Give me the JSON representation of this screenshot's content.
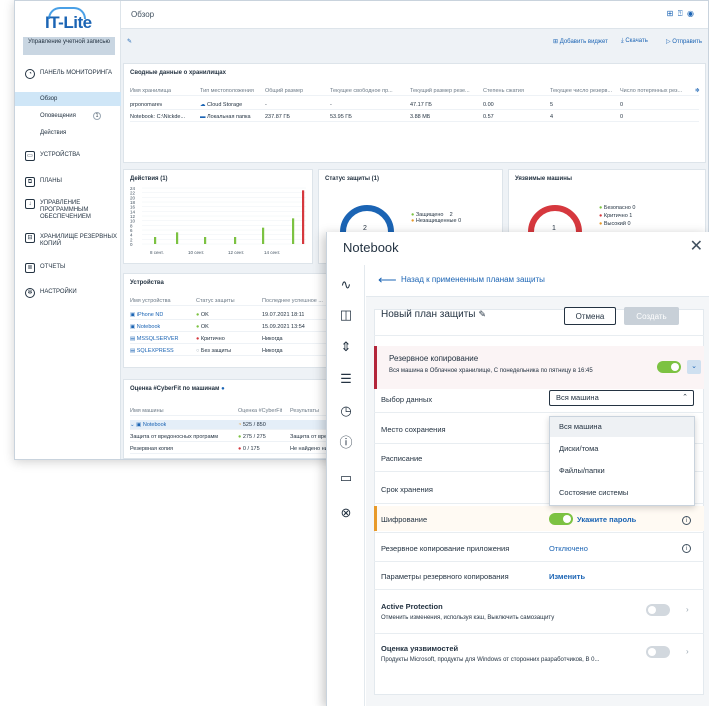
{
  "dashboard": {
    "logo": "IT-Lite",
    "account_button": "Управление учетной записью",
    "page_title": "Обзор",
    "nav": [
      {
        "label": "Панель мониторинга",
        "icon": "gauge-icon"
      },
      {
        "label": "Устройства",
        "icon": "monitor-icon"
      },
      {
        "label": "Планы",
        "icon": "plans-icon"
      },
      {
        "label": "Управление программным обеспечением",
        "icon": "software-icon"
      },
      {
        "label": "Хранилище резервных копий",
        "icon": "storage-icon"
      },
      {
        "label": "Отчеты",
        "icon": "report-icon"
      },
      {
        "label": "Настройки",
        "icon": "settings-icon"
      }
    ],
    "sub_nav": [
      {
        "label": "Обзор"
      },
      {
        "label": "Оповещения",
        "badge": "1"
      },
      {
        "label": "Действия"
      }
    ],
    "actions": {
      "add_widget": "Добавить виджет",
      "download": "Скачать",
      "send": "Отправить"
    },
    "storage_card": {
      "title": "Сводные данные о хранилищах",
      "headers": [
        "Имя хранилища",
        "Тип местоположения",
        "Общий размер",
        "Текущее свободное пр...",
        "Текущий размер резе...",
        "Степень сжатия",
        "Текущее число резерв...",
        "Число потерянных рез..."
      ],
      "rows": [
        [
          "prponomarev",
          "Cloud Storage",
          "-",
          "-",
          "47.17 ГБ",
          "0.00",
          "5",
          "0"
        ],
        [
          "Notebook: C:\\Nickde...",
          "Локальная папка",
          "237.87 ГБ",
          "53.95 ГБ",
          "3.88 МБ",
          "0.57",
          "4",
          "0"
        ]
      ]
    },
    "activities_card": {
      "title": "Действия (1)"
    },
    "protection_card": {
      "title": "Статус защиты (1)",
      "center": "2",
      "legend": [
        {
          "label": "Защищено",
          "value": "2"
        },
        {
          "label": "Незащищенные",
          "value": "0"
        }
      ]
    },
    "vuln_card": {
      "title": "Уязвимые машины",
      "center": "1",
      "legend": [
        {
          "label": "Безопасно",
          "value": "0"
        },
        {
          "label": "Критично",
          "value": "1"
        },
        {
          "label": "Высокий",
          "value": "0"
        }
      ]
    },
    "devices_card": {
      "title": "Устройства",
      "headers": [
        "Имя устройства",
        "Статус защиты",
        "Последнее успешное ..."
      ],
      "rows": [
        [
          "iPhone ND",
          "OK",
          "19.07.2021 18:11"
        ],
        [
          "Notebook",
          "OK",
          "15.09.2021 13:54"
        ],
        [
          "MSSQLSERVER",
          "Критично",
          "Никогда"
        ],
        [
          "SQLEXPRESS",
          "Без защиты",
          "Никогда"
        ]
      ]
    },
    "cyberfit_card": {
      "title": "Оценка #CyberFit по машинам",
      "headers": [
        "Имя машины",
        "Оценка #CyberFit",
        "Результаты"
      ],
      "rows": [
        [
          "Notebook",
          "525 / 850",
          ""
        ],
        [
          "Защита от вредоносных программ",
          "275 / 275",
          "Защита от вред..."
        ],
        [
          "Резервная копия",
          "0 / 175",
          "Не найдено ни..."
        ]
      ]
    },
    "activities_chart": {
      "type": "bar",
      "y_ticks": [
        "24",
        "22",
        "20",
        "18",
        "16",
        "14",
        "12",
        "10",
        "8",
        "6",
        "4",
        "2",
        "0"
      ],
      "x_ticks": [
        "8 сент.",
        "10 сент.",
        "12 сент.",
        "14 сент."
      ]
    }
  },
  "panel": {
    "title": "Notebook",
    "back_label": "Назад к примененным планам защиты",
    "plan_name": "Новый план защиты",
    "cancel": "Отмена",
    "create": "Создать",
    "backup": {
      "title": "Резервное копирование",
      "subtitle": "Вся машина в Облачное хранилище, С понедельника по пятницу в 16:45"
    },
    "rows": {
      "data_selection": "Выбор данных",
      "location": "Место сохранения",
      "schedule": "Расписание",
      "retention": "Срок хранения",
      "encryption": "Шифрование",
      "encryption_link": "Укажите пароль",
      "app_backup": "Резервное копирование приложения",
      "app_backup_value": "Отключено",
      "backup_params": "Параметры резервного копирования",
      "backup_params_value": "Изменить"
    },
    "select_value": "Вся машина",
    "dropdown_options": [
      "Вся машина",
      "Диски/тома",
      "Файлы/папки",
      "Состояние системы"
    ],
    "active_protection": {
      "title": "Active Protection",
      "subtitle": "Отменить изменения, используя кэш, Выключить самозащиту"
    },
    "vuln_assessment": {
      "title": "Оценка уязвимостей",
      "subtitle": "Продукты Microsoft, продукты для Windows от сторонних разработчиков, В 0..."
    }
  }
}
